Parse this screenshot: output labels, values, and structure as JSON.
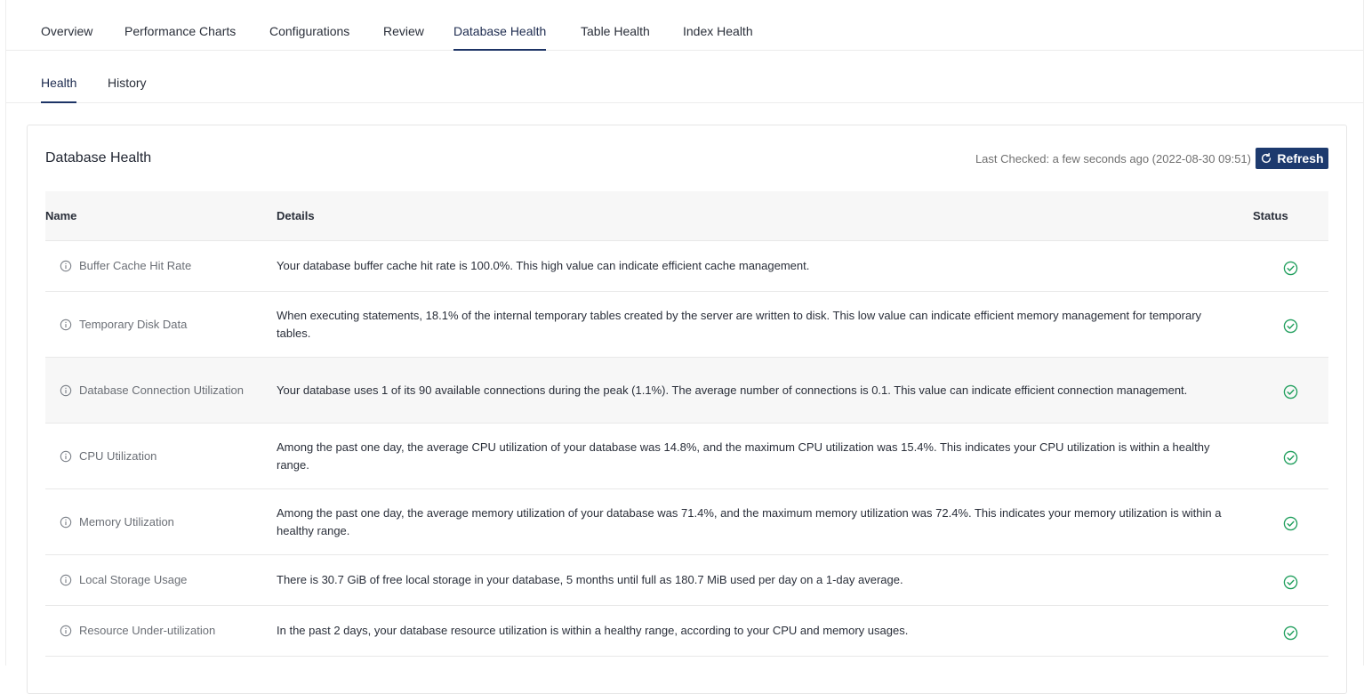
{
  "nav": {
    "tabs": [
      "Overview",
      "Performance Charts",
      "Configurations",
      "Review",
      "Database Health",
      "Table Health",
      "Index Health"
    ],
    "active_tab": "Database Health"
  },
  "subnav": {
    "tabs": [
      "Health",
      "History"
    ],
    "active_tab": "Health"
  },
  "card": {
    "title": "Database Health",
    "last_checked": "Last Checked: a few seconds ago (2022-08-30 09:51)",
    "refresh_label": "Refresh"
  },
  "table": {
    "headers": {
      "name": "Name",
      "details": "Details",
      "status": "Status"
    },
    "rows": [
      {
        "name": "Buffer Cache Hit Rate",
        "details": "Your database buffer cache hit rate is 100.0%. This high value can indicate efficient cache management.",
        "status": "ok"
      },
      {
        "name": "Temporary Disk Data",
        "details": "When executing statements, 18.1% of the internal temporary tables created by the server are written to disk. This low value can indicate efficient memory management for temporary tables.",
        "status": "ok"
      },
      {
        "name": "Database Connection Utilization",
        "details": "Your database uses 1 of its 90 available connections during the peak (1.1%). The average number of connections is 0.1. This value can indicate efficient connection management.",
        "status": "ok"
      },
      {
        "name": "CPU Utilization",
        "details": "Among the past one day, the average CPU utilization of your database was 14.8%, and the maximum CPU utilization was 15.4%. This indicates your CPU utilization is within a healthy range.",
        "status": "ok"
      },
      {
        "name": "Memory Utilization",
        "details": "Among the past one day, the average memory utilization of your database was 71.4%, and the maximum memory utilization was 72.4%. This indicates your memory utilization is within a healthy range.",
        "status": "ok"
      },
      {
        "name": "Local Storage Usage",
        "details": "There is 30.7 GiB of free local storage in your database, 5 months until full as 180.7 MiB used per day on a 1-day average.",
        "status": "ok"
      },
      {
        "name": "Resource Under-utilization",
        "details": "In the past 2 days, your database resource utilization is within a healthy range, according to your CPU and memory usages.",
        "status": "ok"
      }
    ]
  },
  "colors": {
    "primary": "#1d3a6e",
    "status_ok": "#1f9e5c",
    "muted_text": "#6b6f76"
  }
}
